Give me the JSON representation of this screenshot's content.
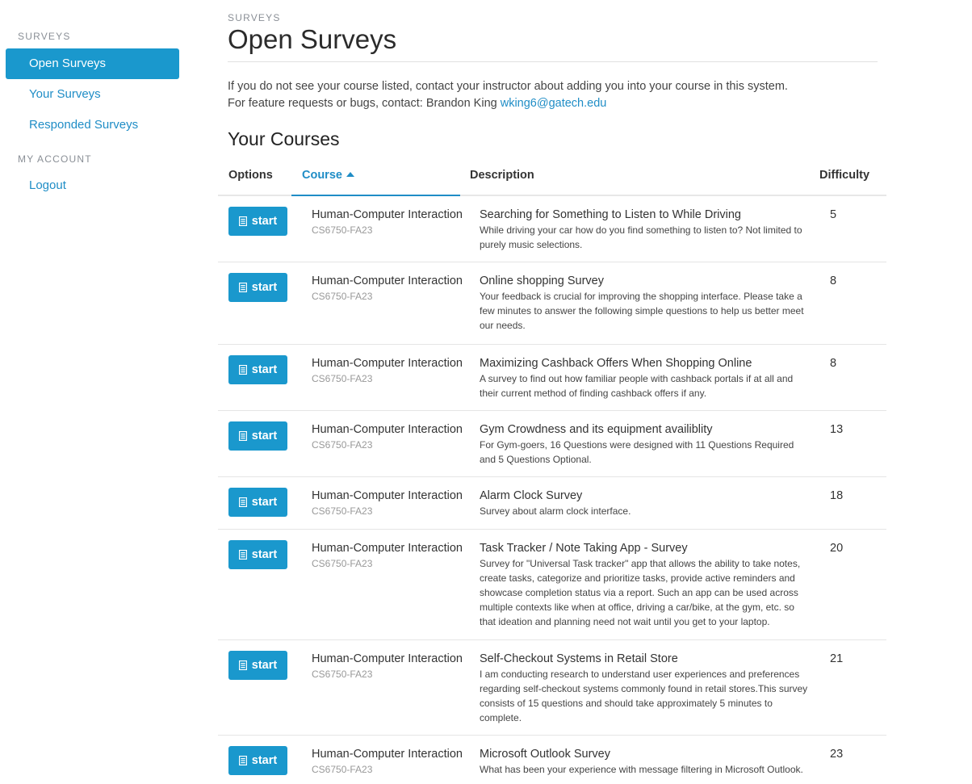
{
  "sidebar": {
    "section_surveys": "SURVEYS",
    "items": [
      {
        "label": "Open Surveys"
      },
      {
        "label": "Your Surveys"
      },
      {
        "label": "Responded Surveys"
      }
    ],
    "section_account": "MY ACCOUNT",
    "logout": "Logout"
  },
  "header": {
    "eyebrow": "SURVEYS",
    "title": "Open Surveys"
  },
  "intro": {
    "line1": "If you do not see your course listed, contact your instructor about adding you into your course in this system.",
    "line2_prefix": "For feature requests or bugs, contact: Brandon King ",
    "email": "wking6@gatech.edu"
  },
  "courses_section": {
    "title": "Your Courses",
    "columns": {
      "options": "Options",
      "course": "Course",
      "description": "Description",
      "difficulty": "Difficulty"
    }
  },
  "start_label": "start",
  "rows": [
    {
      "course": "Human-Computer Interaction",
      "code": "CS6750-FA23",
      "title": "Searching for Something to Listen to While Driving",
      "desc": "While driving your car how do you find something to listen to? Not limited to purely music selections.",
      "difficulty": "5"
    },
    {
      "course": "Human-Computer Interaction",
      "code": "CS6750-FA23",
      "title": "Online shopping Survey",
      "desc": "Your feedback is crucial for improving the shopping interface. Please take a few minutes to answer the following simple questions to help us better meet our needs.",
      "difficulty": "8"
    },
    {
      "course": "Human-Computer Interaction",
      "code": "CS6750-FA23",
      "title": "Maximizing Cashback Offers When Shopping Online",
      "desc": "A survey to find out how familiar people with cashback portals if at all and their current method of finding cashback offers if any.",
      "difficulty": "8"
    },
    {
      "course": "Human-Computer Interaction",
      "code": "CS6750-FA23",
      "title": "Gym Crowdness and its equipment availiblity",
      "desc": "For Gym-goers, 16 Questions were designed with 11 Questions Required and 5 Questions Optional.",
      "difficulty": "13"
    },
    {
      "course": "Human-Computer Interaction",
      "code": "CS6750-FA23",
      "title": "Alarm Clock Survey",
      "desc": "Survey about alarm clock interface.",
      "difficulty": "18"
    },
    {
      "course": "Human-Computer Interaction",
      "code": "CS6750-FA23",
      "title": "Task Tracker / Note Taking App - Survey",
      "desc": "Survey for \"Universal Task tracker\" app that allows the ability to take notes, create tasks, categorize and prioritize tasks, provide active reminders and showcase completion status via a report. Such an app can be used across multiple contexts like when at office, driving a car/bike, at the gym, etc. so that ideation and planning need not wait until you get to your laptop.",
      "difficulty": "20"
    },
    {
      "course": "Human-Computer Interaction",
      "code": "CS6750-FA23",
      "title": "Self-Checkout Systems in Retail Store",
      "desc": "I am conducting research to understand user experiences and preferences regarding self-checkout systems commonly found in retail stores.This survey consists of 15 questions and should take approximately 5 minutes to complete.",
      "difficulty": "21"
    },
    {
      "course": "Human-Computer Interaction",
      "code": "CS6750-FA23",
      "title": "Microsoft Outlook Survey",
      "desc": "What has been your experience with message filtering in Microsoft Outlook.",
      "difficulty": "23"
    }
  ],
  "colors": {
    "accent": "#1a98cd",
    "link": "#1f8dc6"
  }
}
